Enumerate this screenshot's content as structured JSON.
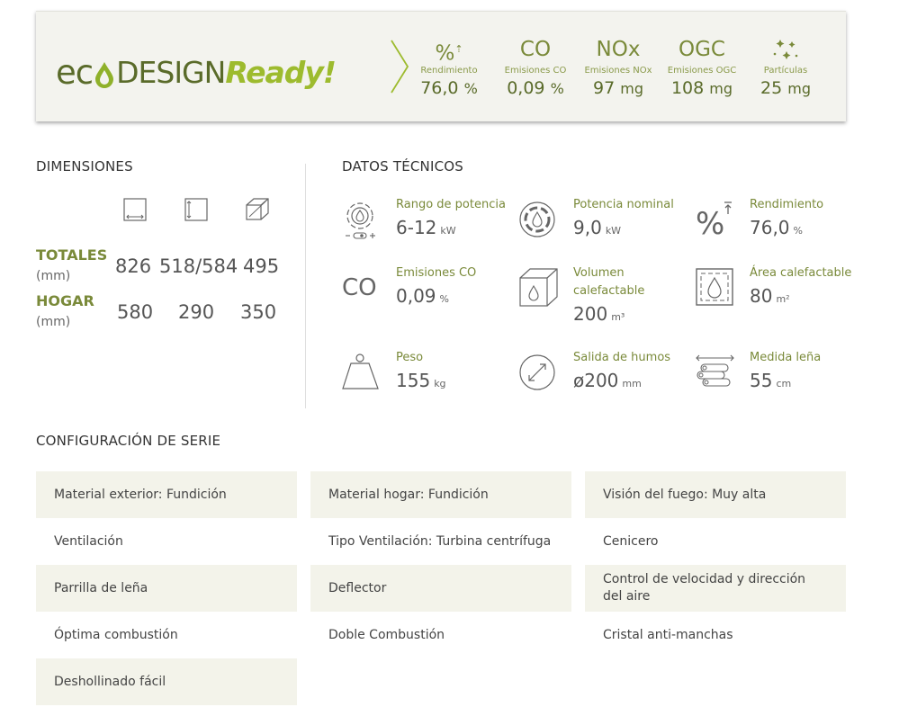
{
  "banner": {
    "logo": {
      "eco": "ec",
      "design": "DESIGN",
      "ready": "Ready!"
    },
    "metrics": [
      {
        "symbol": "%",
        "label": "Rendimiento",
        "value": "76,0",
        "unit": "%"
      },
      {
        "symbol": "CO",
        "label": "Emisiones CO",
        "value": "0,09",
        "unit": "%"
      },
      {
        "symbol": "NOx",
        "label": "Emisiones NOx",
        "value": "97",
        "unit": "mg"
      },
      {
        "symbol": "OGC",
        "label": "Emisiones OGC",
        "value": "108",
        "unit": "mg"
      },
      {
        "symbol": "",
        "label": "Partículas",
        "value": "25",
        "unit": "mg"
      }
    ]
  },
  "dimensions": {
    "title": "DIMENSIONES",
    "rows": [
      {
        "label": "TOTALES",
        "unit": "(mm)",
        "values": [
          "826",
          "518/584",
          "495"
        ]
      },
      {
        "label": "HOGAR",
        "unit": "(mm)",
        "values": [
          "580",
          "290",
          "350"
        ]
      }
    ]
  },
  "tech": {
    "title": "DATOS TÉCNICOS",
    "items": [
      {
        "icon": "power-range-icon",
        "label": "Rango de potencia",
        "value": "6-12",
        "unit": "kW"
      },
      {
        "icon": "nominal-power-icon",
        "label": "Potencia nominal",
        "value": "9,0",
        "unit": "kW"
      },
      {
        "icon": "efficiency-icon",
        "label": "Rendimiento",
        "value": "76,0",
        "unit": "%"
      },
      {
        "symbol": "CO",
        "label": "Emisiones CO",
        "value": "0,09",
        "unit": "%"
      },
      {
        "icon": "heated-volume-icon",
        "label": "Volumen",
        "label2": "calefactable",
        "value": "200",
        "unit": "m³"
      },
      {
        "icon": "heated-area-icon",
        "label": "Área calefactable",
        "value": "80",
        "unit": "m²"
      },
      {
        "icon": "weight-icon",
        "label": "Peso",
        "value": "155",
        "unit": "kg"
      },
      {
        "icon": "flue-outlet-icon",
        "label": "Salida de humos",
        "value": "ø200",
        "unit": "mm"
      },
      {
        "icon": "log-size-icon",
        "label": "Medida leña",
        "value": "55",
        "unit": "cm"
      }
    ]
  },
  "config": {
    "title": "CONFIGURACIÓN DE SERIE",
    "items": [
      "Material exterior: Fundición",
      "Material hogar: Fundición",
      "Visión del fuego: Muy alta",
      "Ventilación",
      "Tipo Ventilación: Turbina centrífuga",
      "Cenicero",
      "Parrilla de leña",
      "Deflector",
      "Control de velocidad y dirección del aire",
      "Óptima combustión",
      "Doble Combustión",
      "Cristal anti-manchas",
      "Deshollinado fácil"
    ]
  },
  "colors": {
    "olive": "#5a6b2a",
    "lime": "#9dbb2e",
    "shaded": "#f3f3ea"
  }
}
